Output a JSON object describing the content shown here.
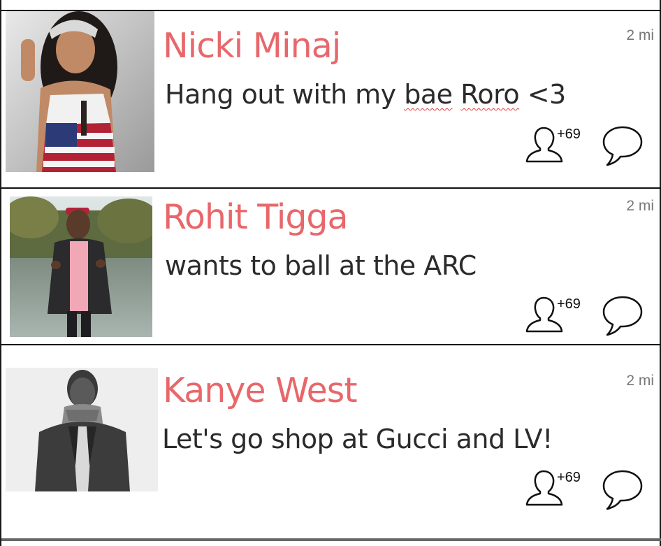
{
  "feed": {
    "posts": [
      {
        "name": "Nicki Minaj",
        "status_parts": [
          "Hang out with my ",
          "bae",
          " ",
          "Roro",
          " <3"
        ],
        "distance": "2 mi",
        "join_count": "+69",
        "avatar_icon": "user-silhouette-icon",
        "comment_icon": "speech-bubble-icon"
      },
      {
        "name": "Rohit Tigga",
        "status": "wants to ball at the ARC",
        "distance": "2 mi",
        "join_count": "+69",
        "avatar_icon": "user-silhouette-icon",
        "comment_icon": "speech-bubble-icon"
      },
      {
        "name": "Kanye West",
        "status": "Let's go shop at Gucci and LV!",
        "distance": "2 mi",
        "join_count": "+69",
        "avatar_icon": "user-silhouette-icon",
        "comment_icon": "speech-bubble-icon"
      }
    ]
  },
  "colors": {
    "name": "#e8676b",
    "status": "#2b2b2b",
    "distance": "#777777",
    "divider": "#111111"
  }
}
